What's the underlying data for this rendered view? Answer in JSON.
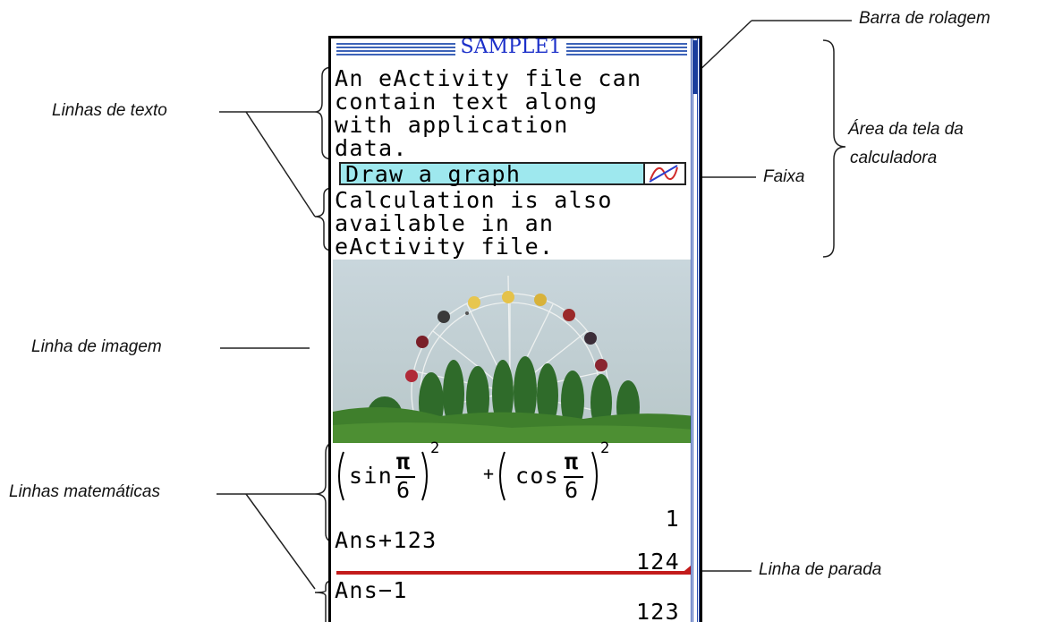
{
  "labels": {
    "scrollbar": "Barra de rolagem",
    "text_lines": "Linhas de texto",
    "screen_area_1": "Área da tela da",
    "screen_area_2": "calculadora",
    "strip": "Faixa",
    "image_line": "Linha de imagem",
    "math_lines": "Linhas matemáticas",
    "stop_line": "Linha de parada"
  },
  "screen": {
    "title": "SAMPLE1",
    "text_block_1": [
      "An eActivity file can",
      "contain text along",
      "with application",
      "data."
    ],
    "strip_label": "Draw a graph",
    "text_block_2": [
      "Calculation is also",
      "available in an",
      "eActivity file."
    ],
    "math": {
      "sin": "sin",
      "cos": "cos",
      "pi": "π",
      "six": "6",
      "exponent": "2",
      "plus": "+",
      "result_1": "1",
      "expr_2": "Ans+123",
      "result_2": "124",
      "expr_3": "Ans−1",
      "result_3": "123"
    }
  },
  "colors": {
    "title_text": "#1b2fc9",
    "title_stripes": "#3d63b8",
    "strip_bg": "#9ee8ee",
    "stop_line": "#c31b1b",
    "scrollbar": "#2b4fb0",
    "graph_icon_red": "#d12a2a",
    "graph_icon_blue": "#2a3fcf"
  }
}
